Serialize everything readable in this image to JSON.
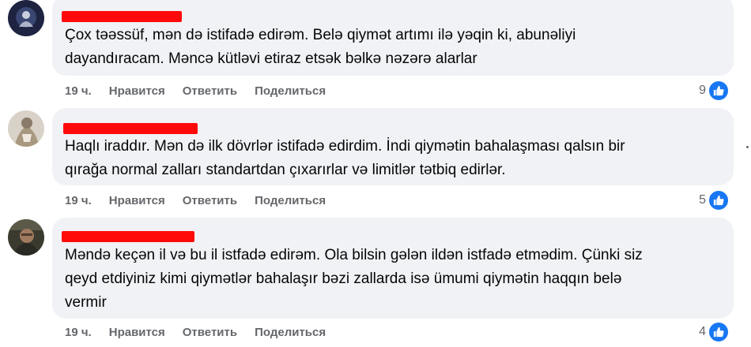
{
  "comments": [
    {
      "author": "",
      "text_lines": [
        "Çox təəssüf, mən də istifadə edirəm. Belə qiymət artımı ilə yəqin ki, abunəliyi",
        "dayandıracam. Məncə kütləvi etiraz etsək bəlkə nəzərə alarlar"
      ],
      "time": "19 ч.",
      "like_label": "Нравится",
      "reply_label": "Ответить",
      "share_label": "Поделиться",
      "reaction_count": "9"
    },
    {
      "author": "",
      "text_lines": [
        "Haqlı iraddır. Mən də ilk dövrlər istifadə edirdim. İndi qiymətin bahalaşması qalsın bir",
        "qırağa normal zalları standartdan çıxarırlar və limitlər tətbiq edirlər."
      ],
      "time": "19 ч.",
      "like_label": "Нравится",
      "reply_label": "Ответить",
      "share_label": "Поделиться",
      "reaction_count": "5"
    },
    {
      "author": "",
      "text_lines": [
        "Məndə keçən il və bu il istfadə edirəm. Ola bilsin gələn ildən istfadə etmədim. Çünki siz",
        "qeyd etdiyiniz kimi qiymətlər bahalaşır bəzi zallarda isə ümumi qiymətin haqqın belə",
        "vermir"
      ],
      "time": "19 ч.",
      "like_label": "Нравится",
      "reply_label": "Ответить",
      "share_label": "Поделиться",
      "reaction_count": "4"
    }
  ],
  "icons": {
    "reaction": "like-thumb-icon",
    "menu": "more-dot-icon"
  },
  "colors": {
    "bubble": "#f0f2f5",
    "redaction": "#ff0a0a",
    "like": "#1877f2",
    "muted": "#65676b"
  }
}
